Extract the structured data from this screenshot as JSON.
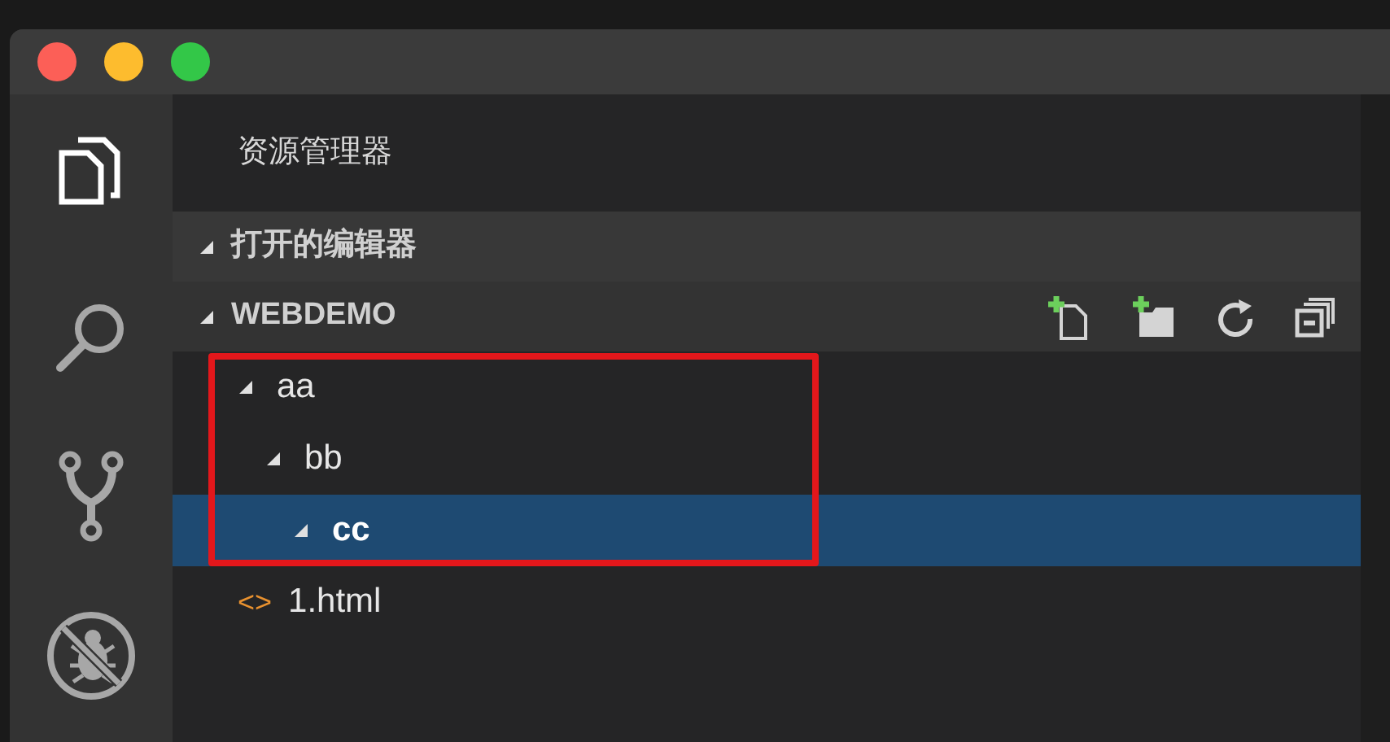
{
  "window": {
    "controls": [
      {
        "color": "#fc5f57"
      },
      {
        "color": "#fdbc2e"
      },
      {
        "color": "#33c748"
      }
    ]
  },
  "activity_bar": [
    {
      "kind": "files",
      "selected": true
    },
    {
      "kind": "search",
      "selected": false
    },
    {
      "kind": "git",
      "selected": false
    },
    {
      "kind": "debug",
      "selected": false
    }
  ],
  "sidebar": {
    "title": "资源管理器",
    "sections": [
      {
        "label": "打开的编辑器",
        "expanded": true,
        "toolbar": false
      },
      {
        "label": "WEBDEMO",
        "expanded": true,
        "toolbar": true,
        "tree": [
          {
            "label": "aa",
            "kind": "folder",
            "expanded": true,
            "selected": false,
            "children": [
              {
                "label": "bb",
                "kind": "folder",
                "expanded": true,
                "selected": false,
                "children": [
                  {
                    "label": "cc",
                    "kind": "folder",
                    "expanded": true,
                    "selected": true
                  }
                ]
              }
            ]
          },
          {
            "label": "1.html",
            "kind": "file",
            "icon": "<>",
            "selected": false
          }
        ]
      }
    ]
  }
}
